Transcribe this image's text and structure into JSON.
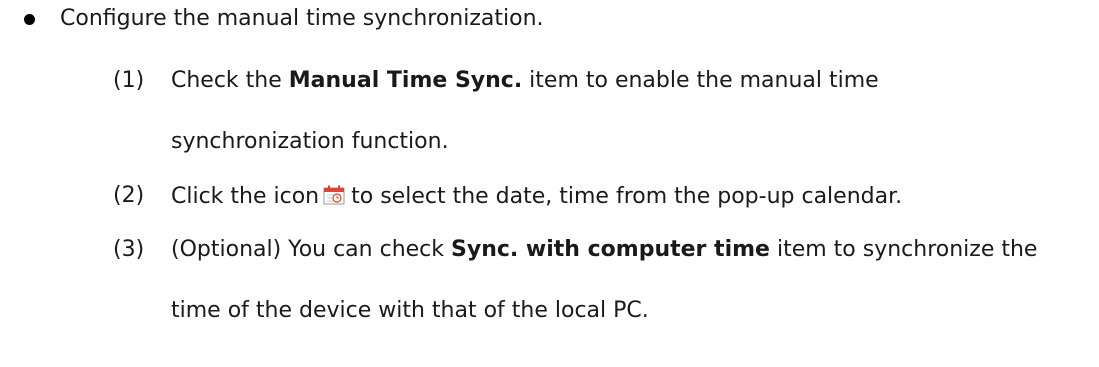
{
  "intro": "Configure the manual time synchronization.",
  "steps": [
    {
      "num": "(1)",
      "pre": "Check the ",
      "bold": "Manual Time Sync.",
      "post": " item to enable the manual time",
      "cont": "synchronization function."
    },
    {
      "num": "(2)",
      "pre": "Click the icon",
      "icon": "calendar-icon",
      "post": "to select the date, time from the pop-up calendar."
    },
    {
      "num": "(3)",
      "pre": "(Optional) You can check ",
      "bold": "Sync. with computer time",
      "post": " item to synchronize the",
      "cont": "time of the device with that of the local PC."
    }
  ],
  "colors": {
    "text": "#1a1a1a",
    "icon_red": "#d9453b",
    "icon_gray": "#9a9a9a"
  }
}
